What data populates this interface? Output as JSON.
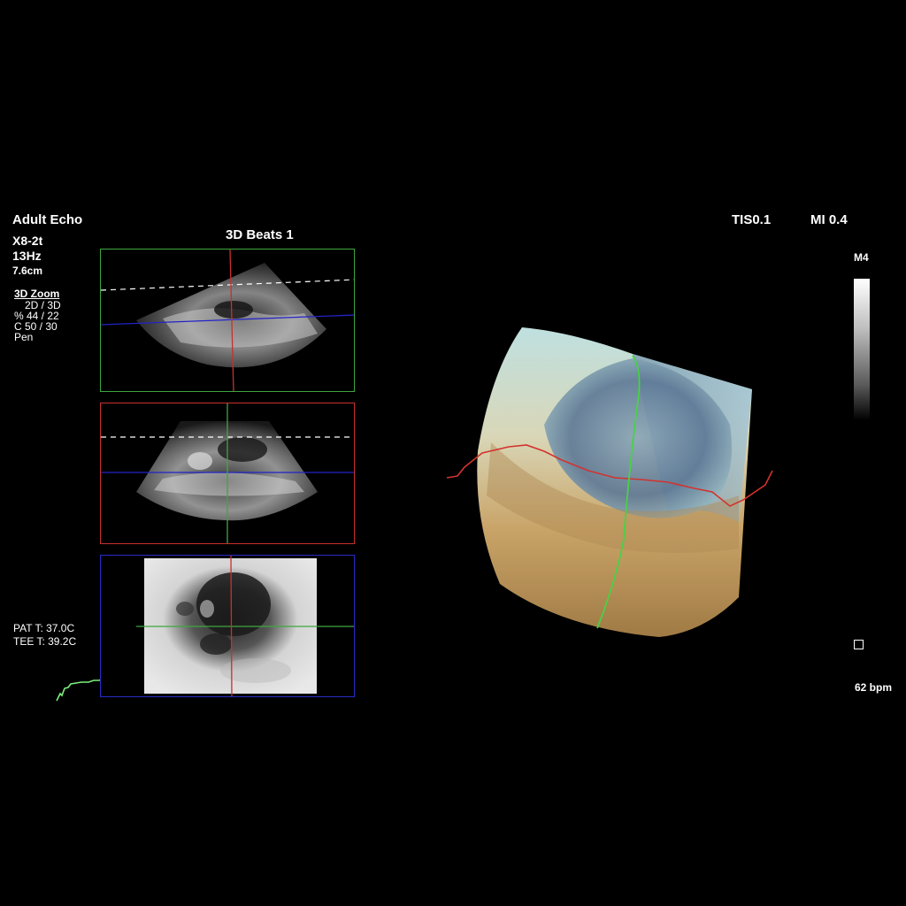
{
  "header": {
    "preset": "Adult Echo",
    "probe": "X8-2t",
    "frame_rate": "13Hz",
    "depth": "7.6cm",
    "mode_title": "3D Beats 1",
    "tis": "TIS0.1",
    "mi": "MI 0.4"
  },
  "zoom_panel": {
    "title": "3D Zoom",
    "lines": [
      "2D / 3D",
      "% 44 / 22",
      "C  50 / 30",
      "Pen"
    ]
  },
  "temps": {
    "patient": "PAT T: 37.0C",
    "tee": "TEE T: 39.2C"
  },
  "gray_map": {
    "label": "M4"
  },
  "heart_rate": "62 bpm",
  "colors": {
    "green_border": "#3fa63f",
    "red_border": "#c8302e",
    "blue_border": "#2a2ac8",
    "ecg": "#7cf07c"
  },
  "panels": [
    {
      "name": "top-2d-panel",
      "border": "green"
    },
    {
      "name": "middle-2d-panel",
      "border": "red"
    },
    {
      "name": "bottom-cscan-panel",
      "border": "blue"
    }
  ]
}
